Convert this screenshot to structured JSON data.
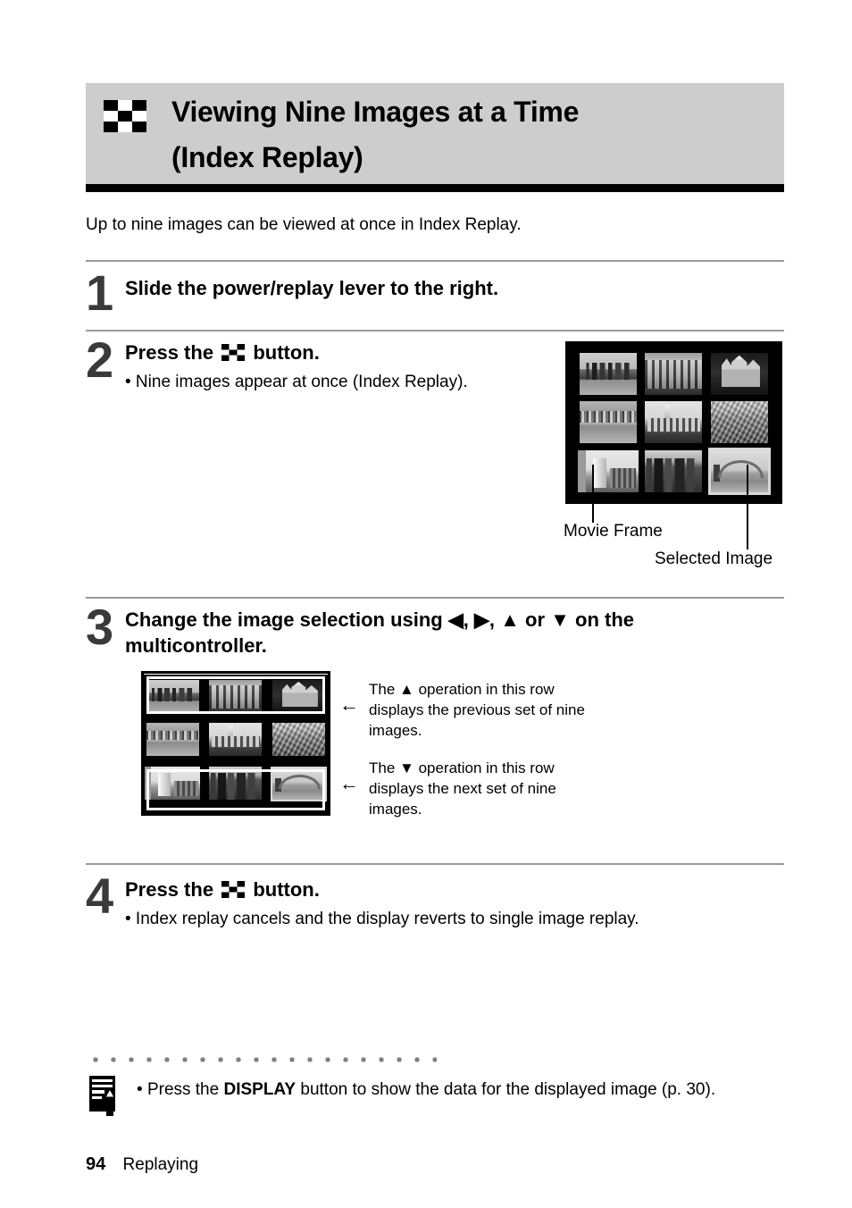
{
  "header": {
    "icon": "index-checker-icon",
    "title_line1": "Viewing Nine Images at a Time",
    "title_line2": "(Index Replay)",
    "bg_color": "#cdcdcd"
  },
  "intro": "Up to nine images can be viewed at once in Index Replay.",
  "steps": [
    {
      "number": "1",
      "title": "Slide the power/replay lever to the right.",
      "bullet": ""
    },
    {
      "number": "2",
      "title_before_icon": "Press the",
      "icon": "index-checker-icon",
      "title_after_icon": "button.",
      "bullet": "• Nine images appear at once (Index Replay)."
    },
    {
      "number": "3",
      "title": "Change the image selection using ◀, ▶, ▲ or ▼ on the multicontroller.",
      "bullet": ""
    },
    {
      "number": "4",
      "title_before_icon": "Press the",
      "icon": "index-checker-icon",
      "title_after_icon": "button.",
      "bullet": "• Index replay cancels and the display reverts to single image replay."
    }
  ],
  "screen_figure": {
    "captions": {
      "movie_frame": "Movie Frame",
      "selected_image": "Selected Image"
    },
    "thumbnails": [
      {
        "id": "thumb-city-skyline",
        "style": "ph-sky-city",
        "movie": false,
        "selected": false
      },
      {
        "id": "thumb-ornate-building",
        "style": "ph-building",
        "movie": false,
        "selected": false
      },
      {
        "id": "thumb-cathedral",
        "style": "ph-church",
        "movie": false,
        "selected": false
      },
      {
        "id": "thumb-waterfront",
        "style": "ph-water",
        "movie": false,
        "selected": false
      },
      {
        "id": "thumb-colonnade",
        "style": "ph-colonnade",
        "movie": false,
        "selected": false
      },
      {
        "id": "thumb-aerial-view",
        "style": "ph-aerial",
        "movie": false,
        "selected": false
      },
      {
        "id": "thumb-monument-movie",
        "style": "ph-monument",
        "movie": true,
        "selected": false
      },
      {
        "id": "thumb-tower-blocks",
        "style": "ph-towers",
        "movie": false,
        "selected": false
      },
      {
        "id": "thumb-harbour-bridge",
        "style": "ph-bridge",
        "movie": false,
        "selected": true
      }
    ]
  },
  "diagram": {
    "arrow_glyph": "←",
    "annotations": [
      {
        "id": "annotation-up",
        "text": "The ▲ operation in this row displays the previous set of nine images."
      },
      {
        "id": "annotation-down",
        "text": "The ▼ operation in this row displays the next set of nine images."
      }
    ],
    "thumbnails": [
      {
        "id": "thumb-city-skyline",
        "style": "ph-sky-city",
        "movie": false,
        "selected": false
      },
      {
        "id": "thumb-ornate-building",
        "style": "ph-building",
        "movie": false,
        "selected": false
      },
      {
        "id": "thumb-cathedral",
        "style": "ph-church",
        "movie": false,
        "selected": false
      },
      {
        "id": "thumb-waterfront",
        "style": "ph-water",
        "movie": false,
        "selected": false
      },
      {
        "id": "thumb-colonnade",
        "style": "ph-colonnade",
        "movie": false,
        "selected": false
      },
      {
        "id": "thumb-aerial-view",
        "style": "ph-aerial",
        "movie": false,
        "selected": false
      },
      {
        "id": "thumb-monument-movie",
        "style": "ph-monument",
        "movie": true,
        "selected": false
      },
      {
        "id": "thumb-tower-blocks",
        "style": "ph-towers",
        "movie": false,
        "selected": false
      },
      {
        "id": "thumb-harbour-bridge",
        "style": "ph-bridge",
        "movie": false,
        "selected": true
      }
    ]
  },
  "note": {
    "icon": "memo-pencil-icon",
    "bullet": "•",
    "text_before": "Press the",
    "emphasis": "DISPLAY",
    "text_after": "button to show the data for the displayed image (p. 30)."
  },
  "footer": {
    "page_number": "94",
    "section": "Replaying"
  }
}
